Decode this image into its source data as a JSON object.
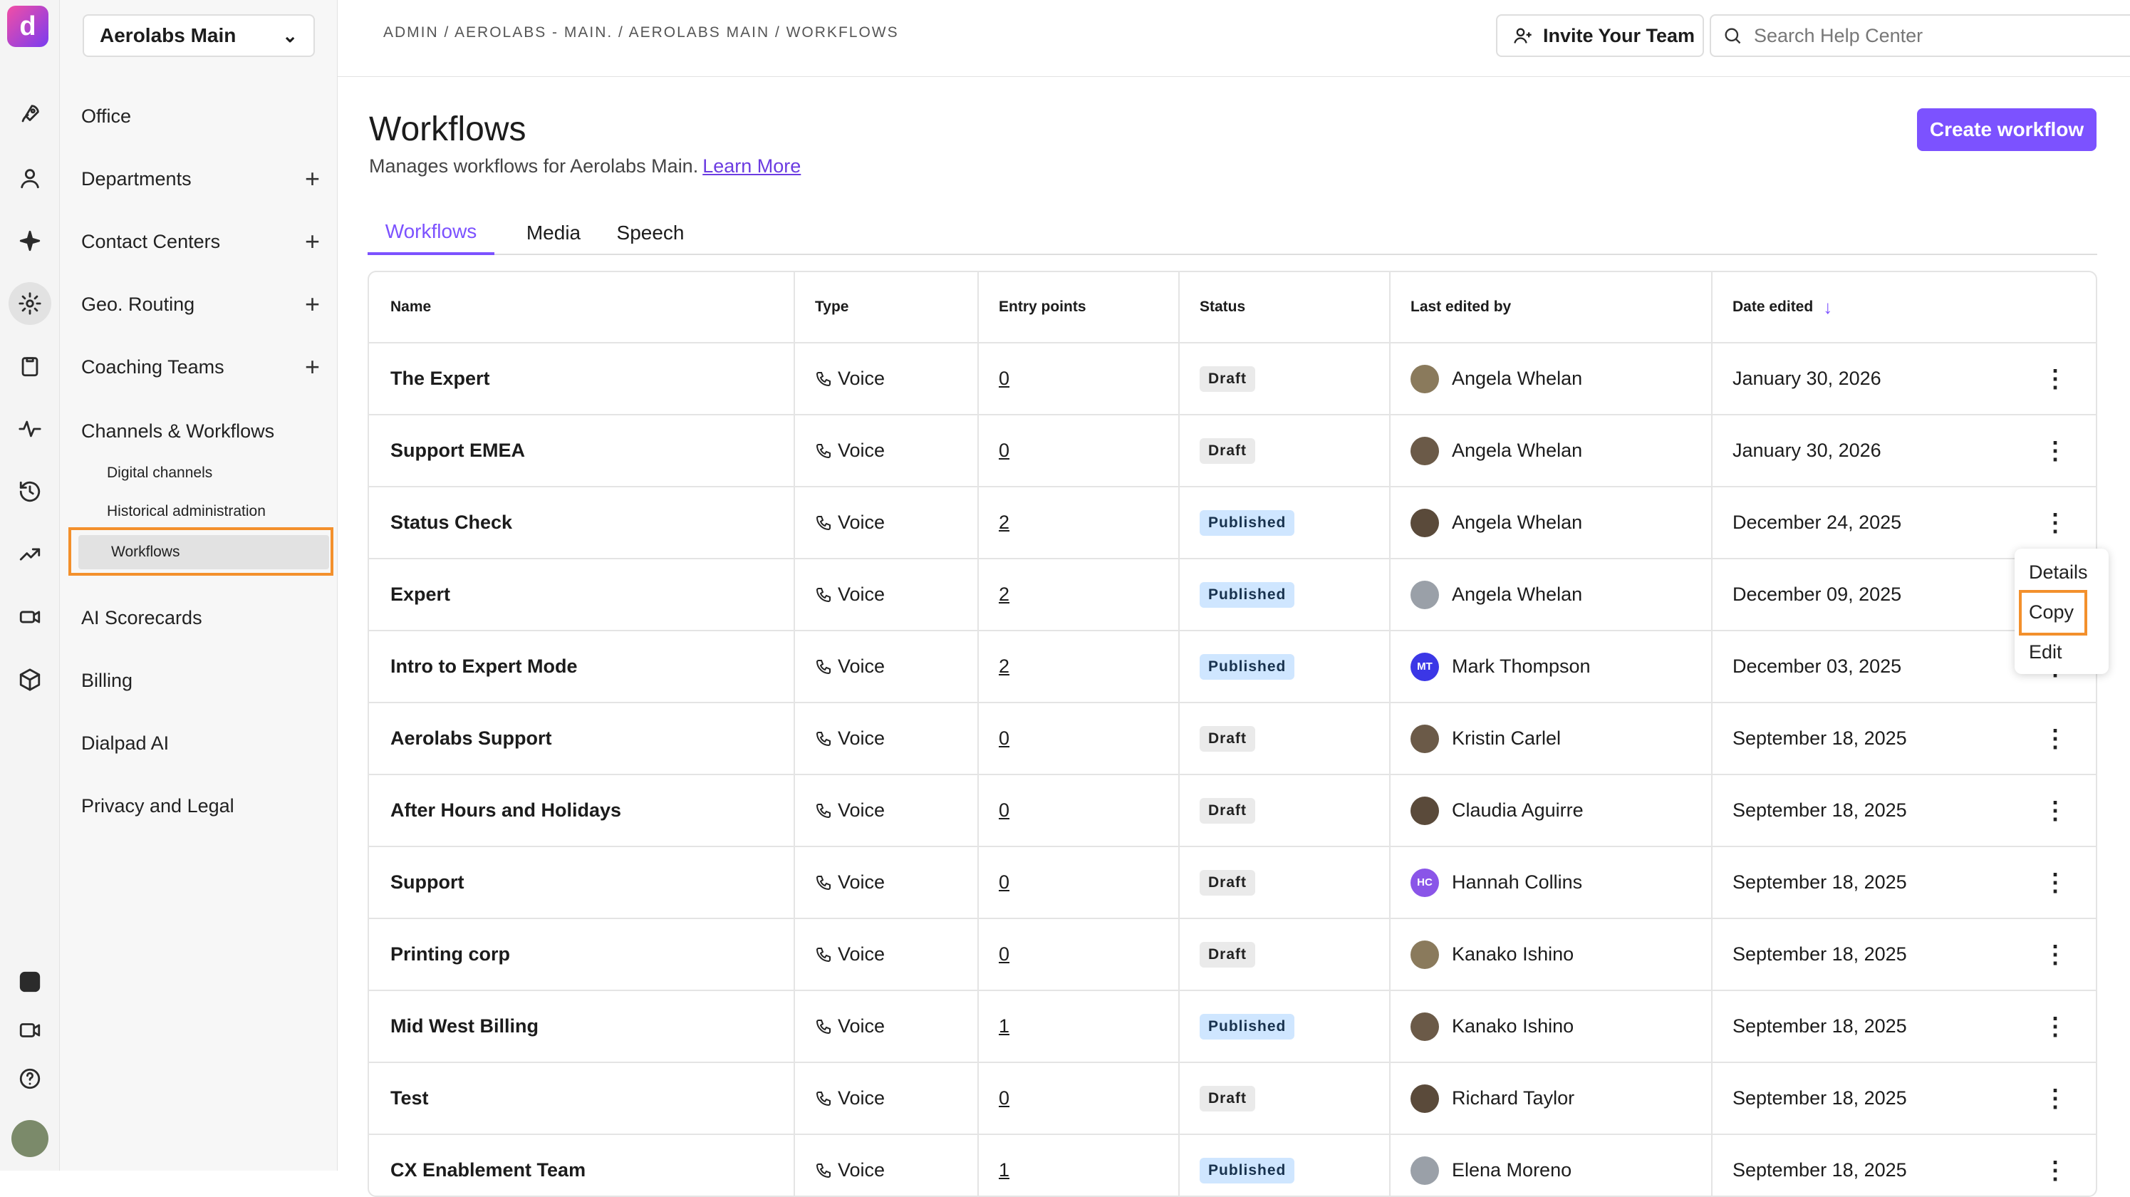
{
  "app": {
    "logo_letter": "d"
  },
  "office_selector": {
    "label": "Aerolabs Main"
  },
  "nav": {
    "items": [
      {
        "label": "Office",
        "plus": false
      },
      {
        "label": "Departments",
        "plus": true
      },
      {
        "label": "Contact Centers",
        "plus": true
      },
      {
        "label": "Geo. Routing",
        "plus": true
      },
      {
        "label": "Coaching Teams",
        "plus": true
      },
      {
        "label": "Channels & Workflows",
        "plus": false
      }
    ],
    "sub_items": [
      "Digital channels",
      "Historical administration",
      "Workflows"
    ],
    "bottom_items": [
      "AI Scorecards",
      "Billing",
      "Dialpad AI",
      "Privacy and Legal"
    ]
  },
  "topbar": {
    "breadcrumb": "ADMIN / AEROLABS - MAIN. / AEROLABS MAIN / WORKFLOWS",
    "invite_label": "Invite Your Team",
    "search_placeholder": "Search Help Center"
  },
  "page": {
    "title": "Workflows",
    "subtitle": "Manages workflows for Aerolabs Main.",
    "learn_more": "Learn More",
    "create_button": "Create workflow"
  },
  "tabs": [
    "Workflows",
    "Media",
    "Speech"
  ],
  "table": {
    "headers": [
      "Name",
      "Type",
      "Entry points",
      "Status",
      "Last edited by",
      "Date edited"
    ],
    "rows": [
      {
        "name": "The Expert",
        "type": "Voice",
        "entry": "0",
        "status": "Draft",
        "editor": "Angela Whelan",
        "initials": "",
        "date": "January 30, 2026"
      },
      {
        "name": "Support EMEA",
        "type": "Voice",
        "entry": "0",
        "status": "Draft",
        "editor": "Angela Whelan",
        "initials": "",
        "date": "January 30, 2026"
      },
      {
        "name": "Status Check",
        "type": "Voice",
        "entry": "2",
        "status": "Published",
        "editor": "Angela Whelan",
        "initials": "",
        "date": "December 24, 2025"
      },
      {
        "name": "Expert",
        "type": "Voice",
        "entry": "2",
        "status": "Published",
        "editor": "Angela Whelan",
        "initials": "",
        "date": "December 09, 2025"
      },
      {
        "name": "Intro to Expert Mode",
        "type": "Voice",
        "entry": "2",
        "status": "Published",
        "editor": "Mark Thompson",
        "initials": "MT",
        "date": "December 03, 2025"
      },
      {
        "name": "Aerolabs Support",
        "type": "Voice",
        "entry": "0",
        "status": "Draft",
        "editor": "Kristin Carlel",
        "initials": "",
        "date": "September 18, 2025"
      },
      {
        "name": "After Hours and Holidays",
        "type": "Voice",
        "entry": "0",
        "status": "Draft",
        "editor": "Claudia Aguirre",
        "initials": "",
        "date": "September 18, 2025"
      },
      {
        "name": "Support",
        "type": "Voice",
        "entry": "0",
        "status": "Draft",
        "editor": "Hannah Collins",
        "initials": "HC",
        "date": "September 18, 2025"
      },
      {
        "name": "Printing corp",
        "type": "Voice",
        "entry": "0",
        "status": "Draft",
        "editor": "Kanako Ishino",
        "initials": "",
        "date": "September 18, 2025"
      },
      {
        "name": "Mid West Billing",
        "type": "Voice",
        "entry": "1",
        "status": "Published",
        "editor": "Kanako Ishino",
        "initials": "",
        "date": "September 18, 2025"
      },
      {
        "name": "Test",
        "type": "Voice",
        "entry": "0",
        "status": "Draft",
        "editor": "Richard Taylor",
        "initials": "",
        "date": "September 18, 2025"
      },
      {
        "name": "CX Enablement Team",
        "type": "Voice",
        "entry": "1",
        "status": "Published",
        "editor": "Elena Moreno",
        "initials": "",
        "date": "September 18, 2025"
      }
    ]
  },
  "row_menu": {
    "items": [
      "Details",
      "Copy",
      "Edit"
    ]
  },
  "colors": {
    "accent": "#7c52ff",
    "highlight": "#f3902c"
  }
}
